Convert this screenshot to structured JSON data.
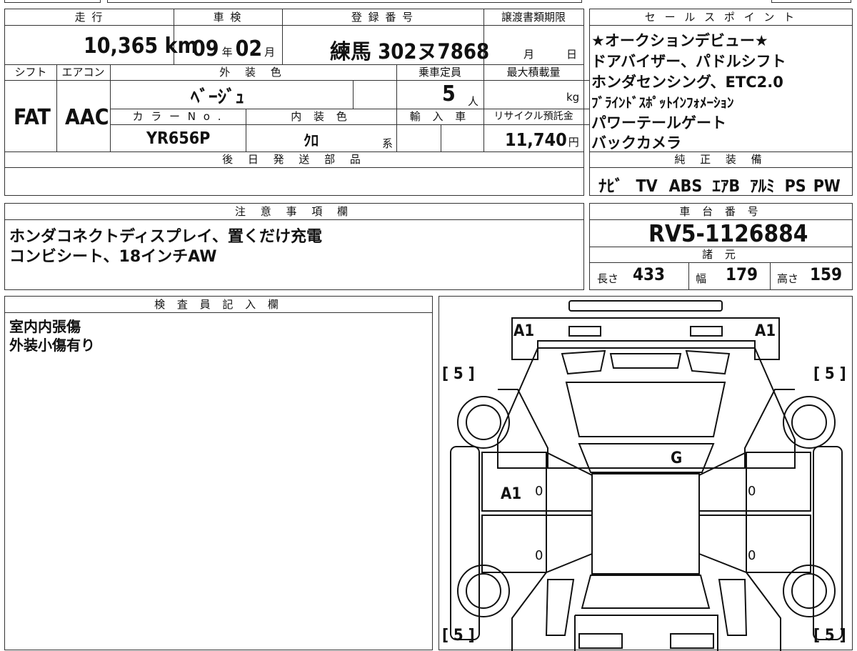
{
  "top": {
    "mileage_label": "走 行",
    "mileage_value": "10,365",
    "mileage_unit": "km",
    "shaken_label": "車 検",
    "shaken_year": "09",
    "shaken_year_unit": "年",
    "shaken_month": "02",
    "shaken_month_unit": "月",
    "reg_label": "登 録 番 号",
    "reg_value": "練馬 302ヌ7868",
    "transfer_label": "譲渡書類期限",
    "transfer_month_unit": "月",
    "transfer_day_unit": "日",
    "shift_label": "シフト",
    "shift_value": "FAT",
    "ac_label": "エアコン",
    "ac_value": "AAC",
    "exterior_label": "外 装 色",
    "exterior_value": "ﾍﾞｰｼﾞｭ",
    "capacity_label": "乗車定員",
    "capacity_value": "5",
    "capacity_unit": "人",
    "maxload_label": "最大積載量",
    "maxload_unit": "kg",
    "colorno_label": "カ ラ ー N o .",
    "colorno_value": "YR656P",
    "interior_label": "内 装 色",
    "interior_value": "ｸﾛ",
    "interior_unit": "系",
    "import_label": "輸 入 車",
    "recycle_label": "リサイクル預託金",
    "recycle_value": "11,740",
    "recycle_unit": "円",
    "later_parts_label": "後 日 発 送 部 品"
  },
  "sales": {
    "label": "セ ー ル ス ポ イ ン ト",
    "lines": [
      "★オークションデビュー★",
      "ドアバイザー、パドルシフト",
      "ホンダセンシング、ETC2.0",
      "ﾌﾞﾗｲﾝﾄﾞｽﾎﾟｯﾄｲﾝﾌｫﾒｰｼｮﾝ",
      "パワーテールゲート",
      "バックカメラ"
    ],
    "equip_label": "純 正 装 備",
    "equip_items": [
      "ﾅﾋﾞ",
      "TV",
      "ABS",
      "ｴｱB",
      "ｱﾙﾐ",
      "PS",
      "PW"
    ]
  },
  "notes": {
    "label": "注 意 事 項 欄",
    "lines": [
      "ホンダコネクトディスプレイ、置くだけ充電",
      "コンビシート、18インチAW"
    ]
  },
  "chassis": {
    "label": "車 台 番 号",
    "value": "RV5-1126884",
    "spec_label": "諸 元",
    "length_label": "長さ",
    "length_value": "433",
    "width_label": "幅",
    "width_value": "179",
    "height_label": "高さ",
    "height_value": "159"
  },
  "inspector": {
    "label": "検 査 員 記 入 欄",
    "lines": [
      "室内内張傷",
      "外装小傷有り"
    ]
  },
  "diagram": {
    "a1_left": "A1",
    "a1_right": "A1",
    "tire_tl": "[ 5 ]",
    "tire_tr": "[ 5 ]",
    "tire_bl": "[ 5 ]",
    "tire_br": "[ 5 ]",
    "g_mark": "G",
    "a1_door": "A1",
    "zero1": "0",
    "zero2": "0",
    "zero3": "0",
    "zero4": "0"
  }
}
